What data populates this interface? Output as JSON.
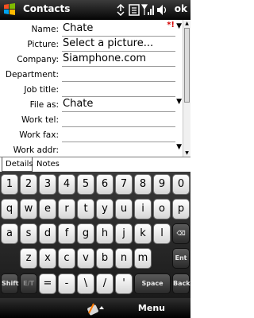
{
  "titlebar": {
    "title": "Contacts",
    "ok_label": "ok",
    "icons": [
      "windows-start-icon",
      "connectivity-icon",
      "messages-icon",
      "signal-icon",
      "volume-icon"
    ]
  },
  "form": {
    "fields": [
      {
        "label": "Name:",
        "value": "Chate",
        "has_flag": true,
        "has_arrow": true
      },
      {
        "label": "Picture:",
        "value": "Select a picture..."
      },
      {
        "label": "Company:",
        "value": "Siamphone.com"
      },
      {
        "label": "Department:",
        "value": ""
      },
      {
        "label": "Job title:",
        "value": ""
      },
      {
        "label": "File as:",
        "value": "Chate",
        "has_arrow": true
      },
      {
        "label": "Work tel:",
        "value": ""
      },
      {
        "label": "Work fax:",
        "value": ""
      },
      {
        "label": "Work addr:",
        "value": "",
        "has_arrow": true
      }
    ]
  },
  "tabs": [
    "Details",
    "Notes"
  ],
  "keyboard": {
    "rows": [
      [
        "1",
        "2",
        "3",
        "4",
        "5",
        "6",
        "7",
        "8",
        "9",
        "0"
      ],
      [
        "q",
        "w",
        "e",
        "r",
        "t",
        "y",
        "u",
        "i",
        "o",
        "p"
      ],
      [
        "a",
        "s",
        "d",
        "f",
        "g",
        "h",
        "j",
        "k",
        "l"
      ],
      [
        "z",
        "x",
        "c",
        "v",
        "b",
        "n",
        "m"
      ]
    ],
    "backspace": "⌫",
    "enter_label": "Ent",
    "shift_label": "Shift",
    "et_label": "E/T",
    "equals": "=",
    "minus": "-",
    "backslash": "\\",
    "slash": "/",
    "apostrophe": "'",
    "space_label": "Space",
    "back_label": "Back"
  },
  "softbar": {
    "menu_label": "Menu"
  }
}
